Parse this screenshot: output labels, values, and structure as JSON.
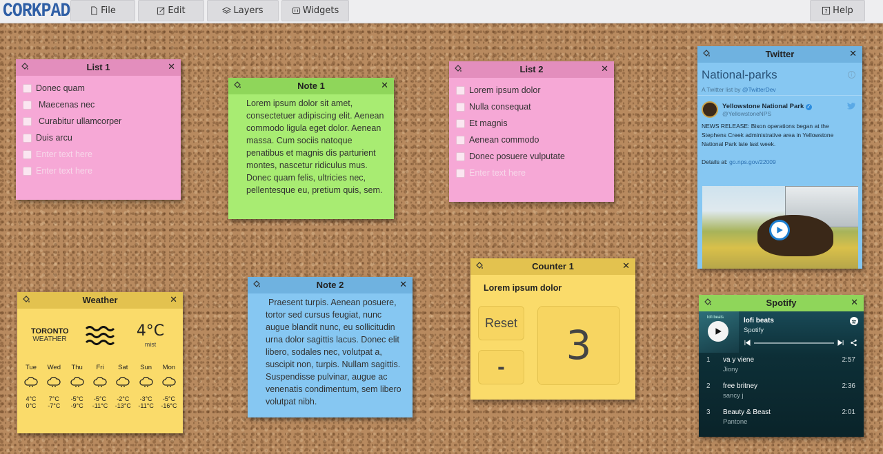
{
  "app": {
    "logo": "CORKPAD"
  },
  "menu": {
    "file": "File",
    "edit": "Edit",
    "layers": "Layers",
    "widgets": "Widgets",
    "help": "Help"
  },
  "list1": {
    "title": "List 1",
    "items": [
      "Donec quam",
      "Maecenas nec",
      "Curabitur ullamcorper",
      "Duis arcu"
    ],
    "placeholders": [
      "Enter text here",
      "Enter text here"
    ]
  },
  "note1": {
    "title": "Note 1",
    "text": "Lorem ipsum dolor sit amet, consectetuer adipiscing elit. Aenean commodo ligula eget dolor. Aenean massa. Cum sociis natoque penatibus et magnis dis parturient montes, nascetur ridiculus mus. Donec quam felis, ultricies nec, pellentesque eu, pretium quis, sem."
  },
  "list2": {
    "title": "List 2",
    "items": [
      "Lorem ipsum dolor",
      "Nulla consequat",
      "Et magnis",
      "Aenean commodo",
      "Donec posuere vulputate"
    ],
    "placeholder": "Enter text here"
  },
  "twitter": {
    "title": "Twitter",
    "list_name": "National-parks",
    "sub_prefix": "A Twitter list by",
    "sub_handle": "@TwitterDev",
    "author": "Yellowstone National Park",
    "handle": "@YellowstoneNPS",
    "text": "NEWS RELEASE: Bison operations began at the Stephens Creek administrative area in Yellowstone National Park late last week.",
    "details_prefix": "Details at:",
    "details_link": "go.nps.gov/22009"
  },
  "weather": {
    "title": "Weather",
    "city": "TORONTO",
    "label": "WEATHER",
    "temp": "4°C",
    "cond": "mist",
    "days": [
      {
        "d": "Tue",
        "hi": "4°C",
        "lo": "0°C"
      },
      {
        "d": "Wed",
        "hi": "7°C",
        "lo": "-7°C"
      },
      {
        "d": "Thu",
        "hi": "-5°C",
        "lo": "-9°C"
      },
      {
        "d": "Fri",
        "hi": "-5°C",
        "lo": "-11°C"
      },
      {
        "d": "Sat",
        "hi": "-2°C",
        "lo": "-13°C"
      },
      {
        "d": "Sun",
        "hi": "-3°C",
        "lo": "-11°C"
      },
      {
        "d": "Mon",
        "hi": "-5°C",
        "lo": "-16°C"
      }
    ]
  },
  "note2": {
    "title": "Note 2",
    "text": "Praesent turpis. Aenean posuere, tortor sed cursus feugiat, nunc augue blandit nunc, eu sollicitudin urna dolor sagittis lacus. Donec elit libero, sodales nec, volutpat a, suscipit non, turpis. Nullam sagittis. Suspendisse pulvinar, augue ac venenatis condimentum, sem libero volutpat nibh."
  },
  "counter": {
    "title": "Counter 1",
    "label": "Lorem ipsum dolor",
    "reset": "Reset",
    "minus": "-",
    "value": "3"
  },
  "spotify": {
    "title": "Spotify",
    "playlist": "lofi beats",
    "owner": "Spotify",
    "art_text": "lofi beats",
    "tracks": [
      {
        "n": "1",
        "name": "va y viene",
        "artist": "Jiony",
        "time": "2:57"
      },
      {
        "n": "2",
        "name": "free britney",
        "artist": "sancy j",
        "time": "2:36"
      },
      {
        "n": "3",
        "name": "Beauty & Beast",
        "artist": "Pantone",
        "time": "2:01"
      }
    ]
  },
  "colors": {
    "logo": "#2f5fa6",
    "pink": "#f6a8d6",
    "green": "#a8ec72",
    "blue": "#86c7f2",
    "yellow": "#fadb6a",
    "spotify_bg": "#0c2d36"
  }
}
